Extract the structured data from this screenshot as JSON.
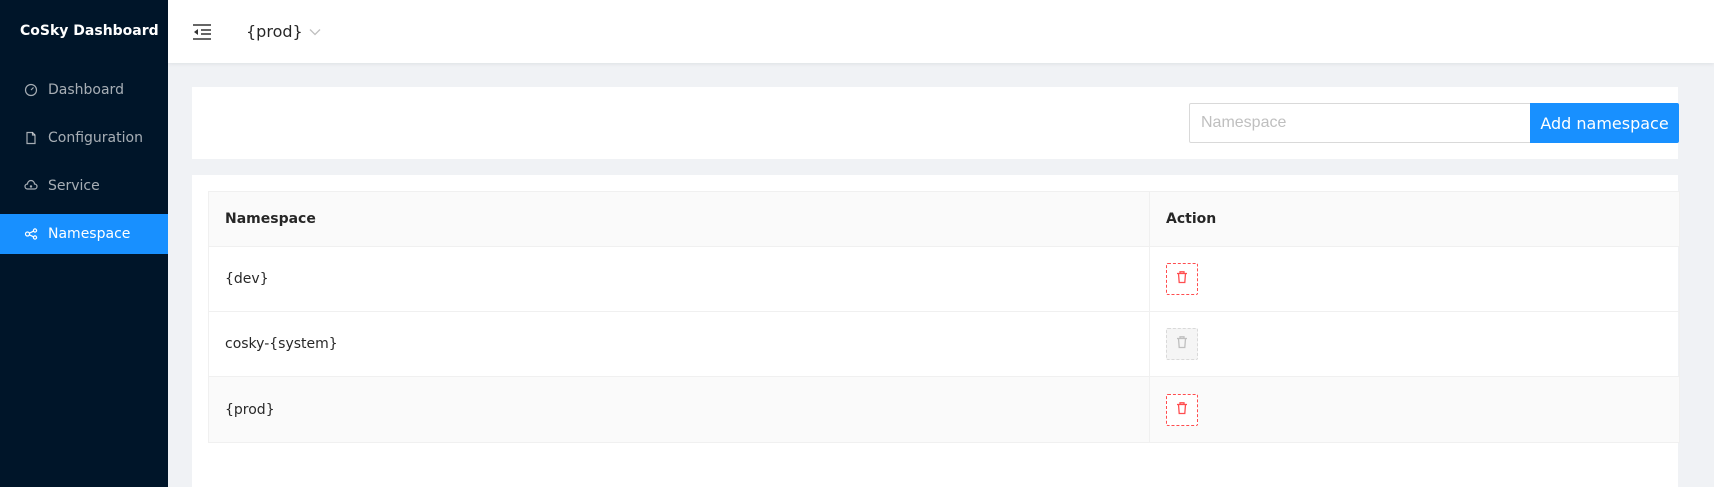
{
  "app": {
    "title": "CoSky Dashboard"
  },
  "sidebar": {
    "items": [
      {
        "label": "Dashboard",
        "icon": "dashboard-icon",
        "active": false
      },
      {
        "label": "Configuration",
        "icon": "file-icon",
        "active": false
      },
      {
        "label": "Service",
        "icon": "cloud-icon",
        "active": false
      },
      {
        "label": "Namespace",
        "icon": "cluster-icon",
        "active": true
      }
    ]
  },
  "header": {
    "current_namespace": "{prod}"
  },
  "toolbar": {
    "namespace_placeholder": "Namespace",
    "add_label": "Add namespace"
  },
  "table": {
    "columns": [
      "Namespace",
      "Action"
    ],
    "rows": [
      {
        "namespace": "{dev}",
        "deletable": true
      },
      {
        "namespace": "cosky-{system}",
        "deletable": false
      },
      {
        "namespace": "{prod}",
        "deletable": true
      }
    ]
  },
  "colors": {
    "primary": "#1890ff",
    "sider": "#001529",
    "danger": "#ff4d4f"
  }
}
